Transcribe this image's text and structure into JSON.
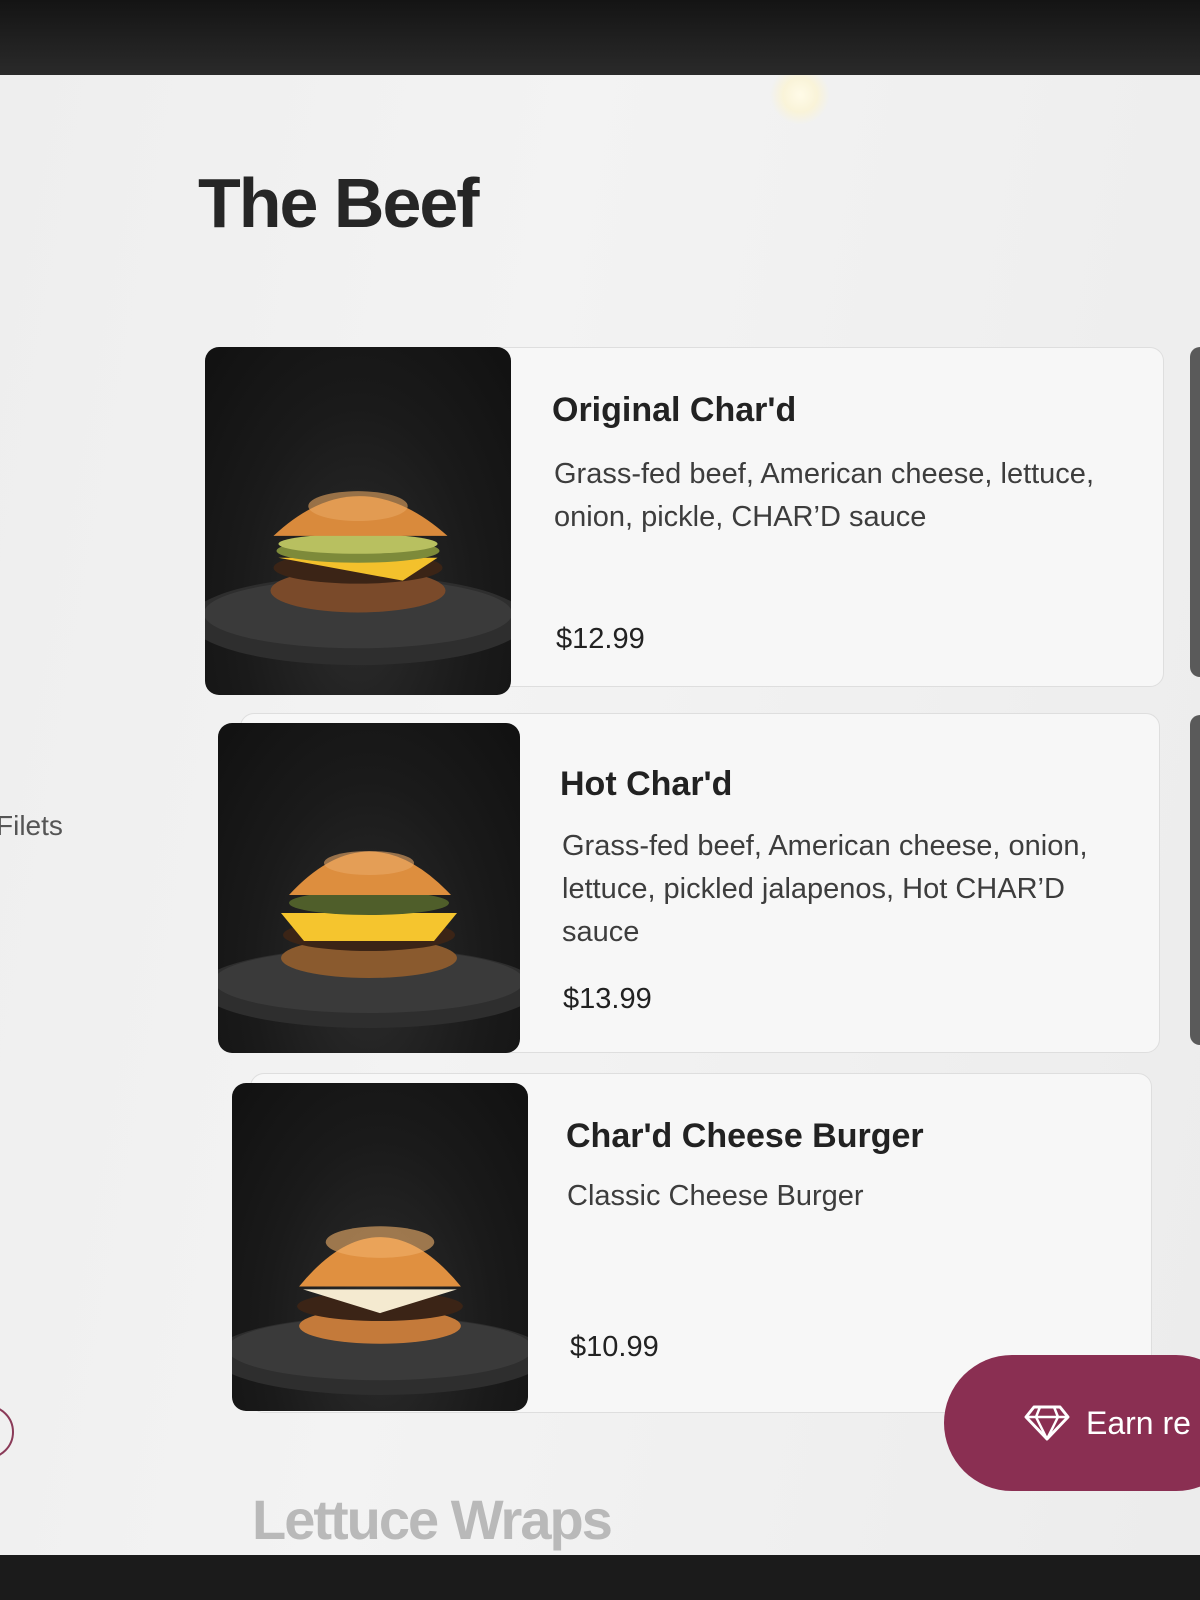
{
  "side_nav": {
    "visible_label": "Filets"
  },
  "sections": [
    {
      "title": "The Beef",
      "items": [
        {
          "name": "Original Char'd",
          "description": "Grass-fed beef, American cheese, lettuce, onion, pickle, CHAR’D sauce",
          "price": "$12.99"
        },
        {
          "name": "Hot Char'd",
          "description": "Grass-fed beef, American cheese, onion, lettuce, pickled jalapenos, Hot CHAR’D sauce",
          "price": "$13.99"
        },
        {
          "name": "Char'd Cheese Burger",
          "description": "Classic Cheese Burger",
          "price": "$10.99"
        }
      ]
    },
    {
      "title": "Lettuce Wraps"
    }
  ],
  "rewards_button": {
    "label": "Earn re",
    "icon": "diamond-icon"
  },
  "colors": {
    "accent": "#8a2f52",
    "background": "#f0f0f0",
    "text": "#222222"
  }
}
